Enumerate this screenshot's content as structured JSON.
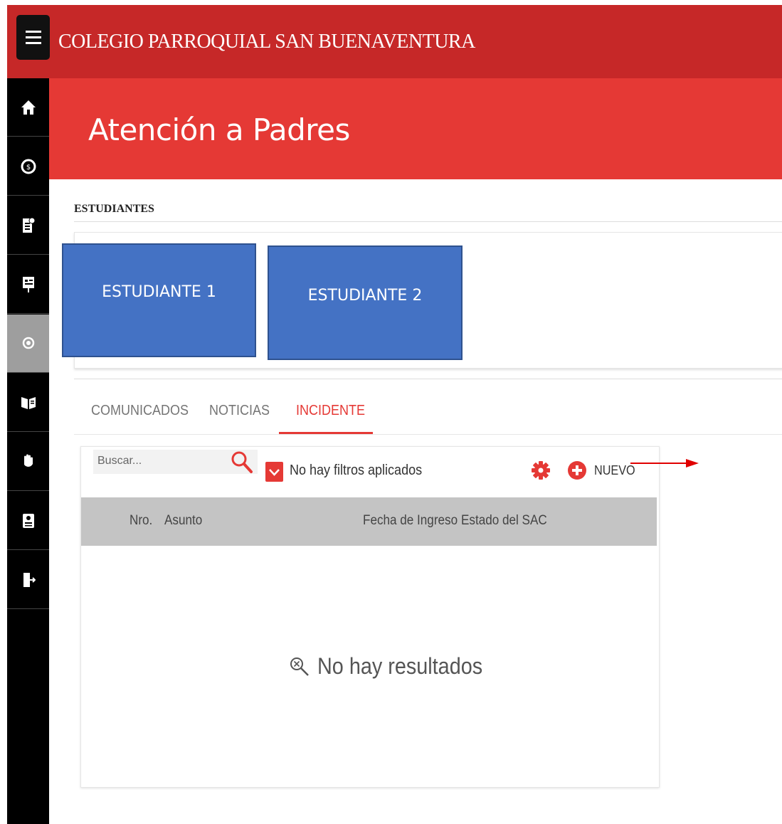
{
  "app": {
    "title": "COLEGIO PARROQUIAL SAN BUENAVENTURA"
  },
  "page": {
    "title": "Atención a Padres"
  },
  "students": {
    "section_label": "ESTUDIANTES",
    "items": [
      {
        "label": "ESTUDIANTE 1"
      },
      {
        "label": "ESTUDIANTE 2"
      }
    ]
  },
  "tabs": [
    {
      "label": "COMUNICADOS",
      "active": false
    },
    {
      "label": "NOTICIAS",
      "active": false
    },
    {
      "label": "INCIDENTE",
      "active": true
    }
  ],
  "toolbar": {
    "search_placeholder": "Buscar...",
    "filter_text": "No hay filtros aplicados",
    "new_label": "NUEVO"
  },
  "grid": {
    "columns": [
      "Nro.",
      "Asunto",
      "Fecha de Ingreso",
      "Estado del SAC"
    ],
    "empty_text": "No hay resultados"
  },
  "sidebar": {
    "items": [
      {
        "icon": "home-icon"
      },
      {
        "icon": "payments-icon"
      },
      {
        "icon": "grades-icon"
      },
      {
        "icon": "schedule-icon"
      },
      {
        "icon": "support-icon",
        "active": true
      },
      {
        "icon": "library-icon"
      },
      {
        "icon": "hand-icon"
      },
      {
        "icon": "id-card-icon"
      },
      {
        "icon": "logout-icon"
      }
    ]
  },
  "colors": {
    "topbar": "#c62828",
    "header": "#e53935",
    "accent": "#e53935",
    "student_card": "#4472c4",
    "rail": "#000000"
  }
}
